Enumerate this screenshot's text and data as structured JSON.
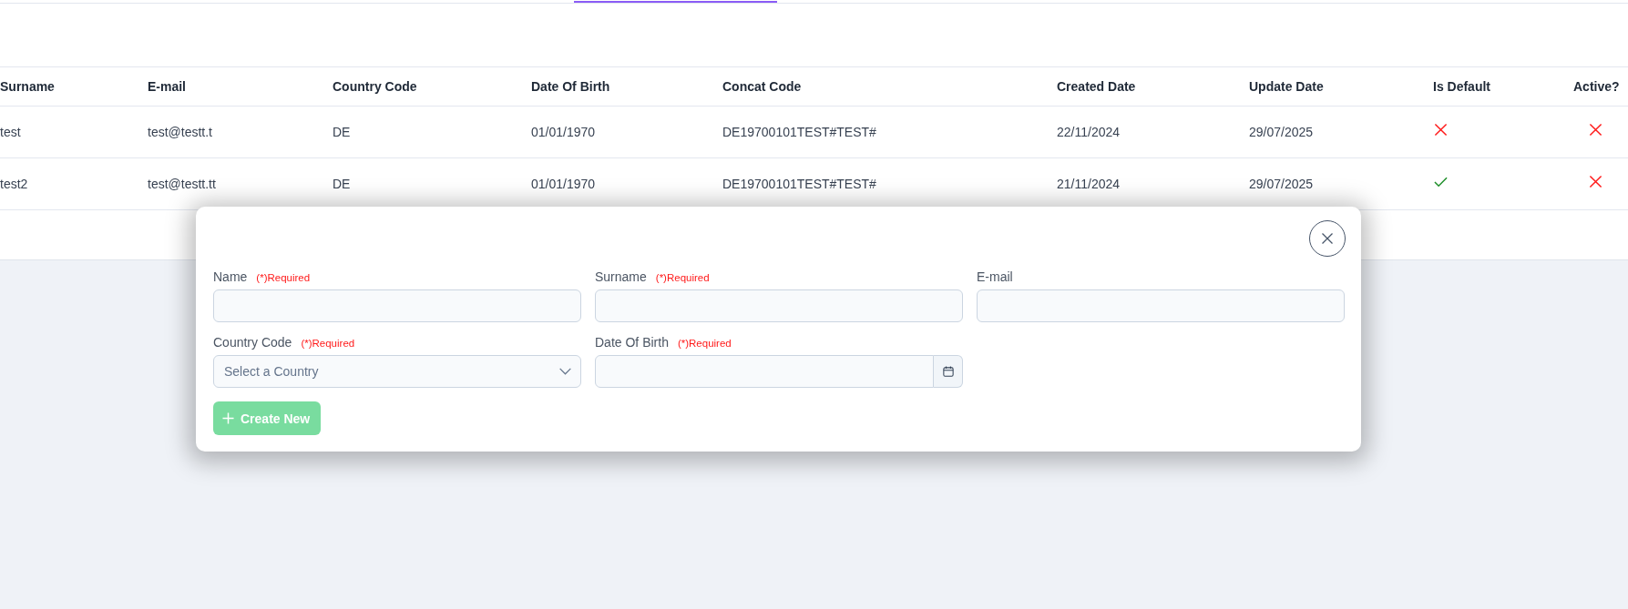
{
  "table": {
    "columns": [
      "Surname",
      "E-mail",
      "Country Code",
      "Date Of Birth",
      "Concat Code",
      "Created Date",
      "Update Date",
      "Is Default",
      "Active?"
    ],
    "rows": [
      {
        "surname": "test",
        "email": "test@testt.t",
        "country_code": "DE",
        "date_of_birth": "01/01/1970",
        "concat_code": "DE19700101TEST#TEST#",
        "created_date": "22/11/2024",
        "update_date": "29/07/2025",
        "is_default": false,
        "active": false
      },
      {
        "surname": "test2",
        "email": "test@testt.tt",
        "country_code": "DE",
        "date_of_birth": "01/01/1970",
        "concat_code": "DE19700101TEST#TEST#",
        "created_date": "21/11/2024",
        "update_date": "29/07/2025",
        "is_default": true,
        "active": false
      }
    ]
  },
  "dialog": {
    "fields": [
      {
        "label": "Name",
        "required_note": "(*)Required",
        "kind": "text"
      },
      {
        "label": "Surname",
        "required_note": "(*)Required",
        "kind": "text"
      },
      {
        "label": "E-mail",
        "kind": "text"
      },
      {
        "label": "Country Code",
        "required_note": "(*)Required",
        "kind": "select",
        "placeholder": "Select a Country"
      },
      {
        "label": "Date Of Birth",
        "required_note": "(*)Required",
        "kind": "date"
      }
    ],
    "create_button": {
      "label": "Create New",
      "disabled": true
    }
  }
}
